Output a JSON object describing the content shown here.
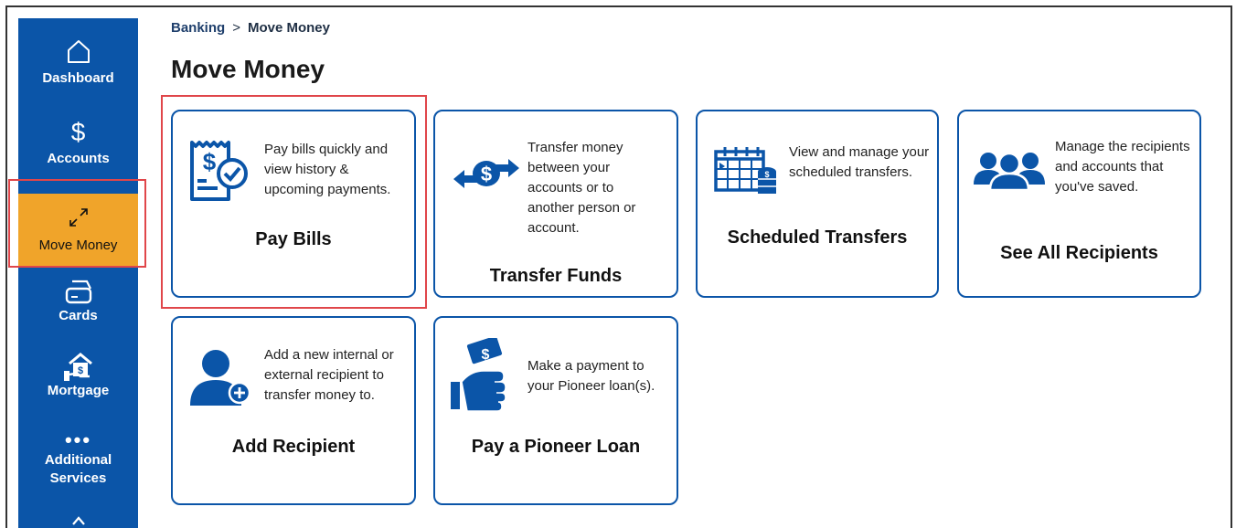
{
  "sidebar": {
    "items": [
      {
        "label": "Dashboard",
        "icon": "home-icon"
      },
      {
        "label": "Accounts",
        "icon": "dollar-icon"
      },
      {
        "label": "Move Money",
        "icon": "arrows-diagonal-icon"
      },
      {
        "label": "Cards",
        "icon": "credit-card-icon"
      },
      {
        "label": "Mortgage",
        "icon": "house-hand-icon"
      },
      {
        "label": "Additional Services",
        "icon": "more-dots-icon"
      }
    ]
  },
  "breadcrumb": {
    "parent": "Banking",
    "separator": ">",
    "current": "Move Money"
  },
  "page": {
    "title": "Move Money"
  },
  "cards": [
    {
      "title": "Pay Bills",
      "description": "Pay bills quickly and view history & upcoming payments.",
      "icon": "bill-check-icon"
    },
    {
      "title": "Transfer Funds",
      "description": "Transfer money between your accounts or to another person or account.",
      "icon": "transfer-arrows-icon"
    },
    {
      "title": "Scheduled Transfers",
      "description": "View and manage your scheduled transfers.",
      "icon": "calendar-coins-icon"
    },
    {
      "title": "See All Recipients",
      "description": "Manage the recipients and accounts that you've saved.",
      "icon": "people-group-icon"
    },
    {
      "title": "Add Recipient",
      "description": "Add a new internal or external recipient to transfer money to.",
      "icon": "add-person-icon"
    },
    {
      "title": "Pay a Pioneer Loan",
      "description": "Make a payment to your Pioneer loan(s).",
      "icon": "hand-money-icon"
    }
  ],
  "colors": {
    "brand_blue": "#0b55a8",
    "active_orange": "#f0a42a",
    "highlight_red": "#e0464a"
  }
}
